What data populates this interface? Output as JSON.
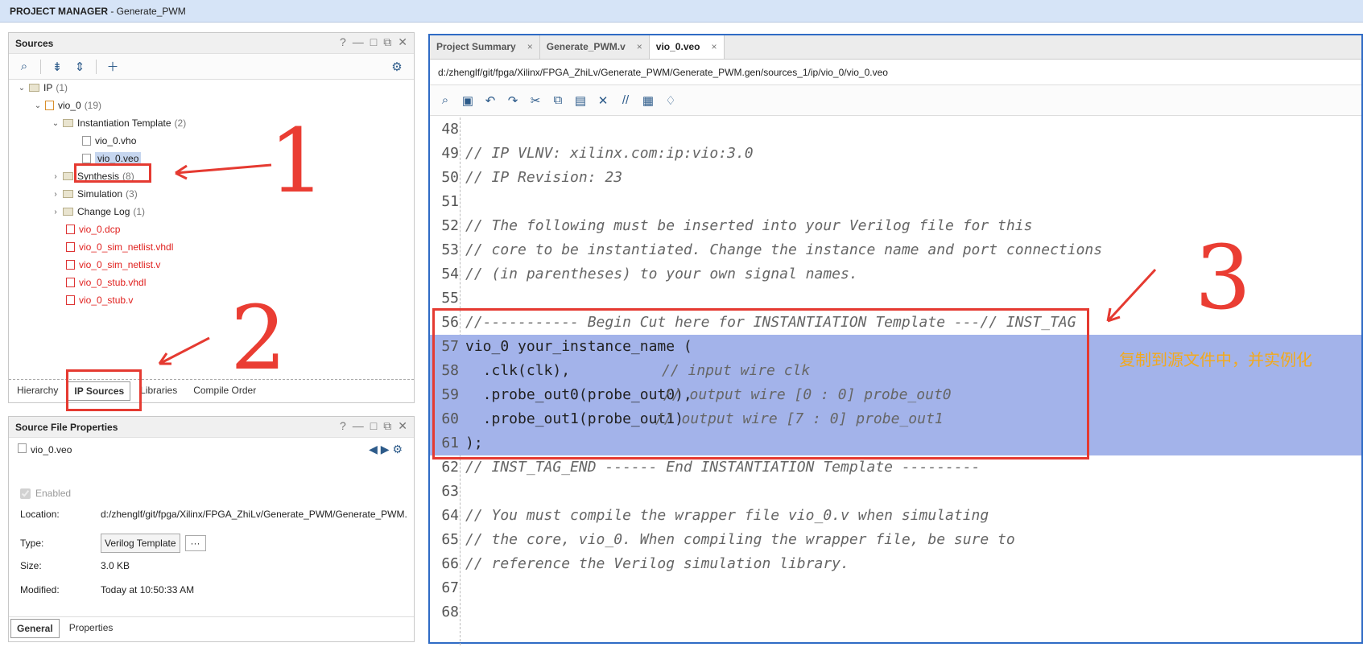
{
  "titlebar": {
    "bold": "PROJECT MANAGER",
    "rest": " - Generate_PWM"
  },
  "sources": {
    "title": "Sources",
    "tree": [
      {
        "label": "IP",
        "count": "(1)"
      },
      {
        "label": "vio_0",
        "count": "(19)"
      },
      {
        "label": "Instantiation Template",
        "count": "(2)"
      },
      {
        "label": "vio_0.vho"
      },
      {
        "label": "vio_0.veo"
      },
      {
        "label": "Synthesis",
        "count": "(8)"
      },
      {
        "label": "Simulation",
        "count": "(3)"
      },
      {
        "label": "Change Log",
        "count": "(1)"
      },
      {
        "label": "vio_0.dcp"
      },
      {
        "label": "vio_0_sim_netlist.vhdl"
      },
      {
        "label": "vio_0_sim_netlist.v"
      },
      {
        "label": "vio_0_stub.vhdl"
      },
      {
        "label": "vio_0_stub.v"
      }
    ],
    "tabs": [
      "Hierarchy",
      "IP Sources",
      "Libraries",
      "Compile Order"
    ]
  },
  "props": {
    "title": "Source File Properties",
    "file": "vio_0.veo",
    "enabled": "Enabled",
    "location_label": "Location:",
    "location": "d:/zhenglf/git/fpga/Xilinx/FPGA_ZhiLv/Generate_PWM/Generate_PWM.",
    "type_label": "Type:",
    "type": "Verilog Template",
    "size_label": "Size:",
    "size": "3.0 KB",
    "modified_label": "Modified:",
    "modified": "Today at 10:50:33 AM",
    "tabs": [
      "General",
      "Properties"
    ]
  },
  "editor": {
    "tabs": [
      "Project Summary",
      "Generate_PWM.v",
      "vio_0.veo"
    ],
    "path": "d:/zhenglf/git/fpga/Xilinx/FPGA_ZhiLv/Generate_PWM/Generate_PWM.gen/sources_1/ip/vio_0/vio_0.veo",
    "lines": [
      {
        "n": "48",
        "t": ""
      },
      {
        "n": "49",
        "t": "// IP VLNV: xilinx.com:ip:vio:3.0"
      },
      {
        "n": "50",
        "t": "// IP Revision: 23"
      },
      {
        "n": "51",
        "t": ""
      },
      {
        "n": "52",
        "t": "// The following must be inserted into your Verilog file for this"
      },
      {
        "n": "53",
        "t": "// core to be instantiated. Change the instance name and port connections"
      },
      {
        "n": "54",
        "t": "// (in parentheses) to your own signal names."
      },
      {
        "n": "55",
        "t": ""
      },
      {
        "n": "56",
        "t": "//----------- Begin Cut here for INSTANTIATION Template ---// INST_TAG"
      },
      {
        "n": "57",
        "t": "vio_0 your_instance_name ("
      },
      {
        "n": "58",
        "t": "  .clk(clk),",
        "c": "// input wire clk"
      },
      {
        "n": "59",
        "t": "  .probe_out0(probe_out0),",
        "c": "// output wire [0 : 0] probe_out0"
      },
      {
        "n": "60",
        "t": "  .probe_out1(probe_out1)",
        "c": "// output wire [7 : 0] probe_out1"
      },
      {
        "n": "61",
        "t": ");"
      },
      {
        "n": "62",
        "t": "// INST_TAG_END ------ End INSTANTIATION Template ---------"
      },
      {
        "n": "63",
        "t": ""
      },
      {
        "n": "64",
        "t": "// You must compile the wrapper file vio_0.v when simulating"
      },
      {
        "n": "65",
        "t": "// the core, vio_0. When compiling the wrapper file, be sure to"
      },
      {
        "n": "66",
        "t": "// reference the Verilog simulation library."
      },
      {
        "n": "67",
        "t": ""
      },
      {
        "n": "68",
        "t": ""
      }
    ],
    "note": "复制到源文件中，并实例化"
  },
  "annotations": [
    "1",
    "2",
    "3"
  ]
}
